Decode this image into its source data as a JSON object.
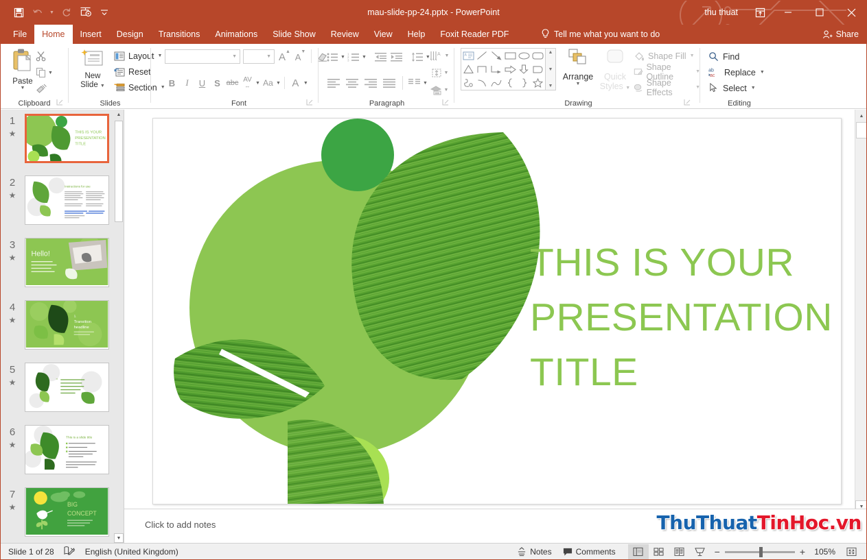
{
  "window": {
    "title": "mau-slide-pp-24.pptx  -  PowerPoint",
    "account": "thu thuat",
    "accent": "#b7472a",
    "quick_access": [
      "save-icon",
      "undo-icon",
      "redo-icon",
      "start-slideshow-icon",
      "customize-qat-icon"
    ],
    "buttons": {
      "ribbon_display": "ribbon-display-options-icon",
      "minimize": "—",
      "maximize": "☐",
      "close": "✕"
    }
  },
  "tabs": [
    {
      "label": "File",
      "active": false
    },
    {
      "label": "Home",
      "active": true
    },
    {
      "label": "Insert",
      "active": false
    },
    {
      "label": "Design",
      "active": false
    },
    {
      "label": "Transitions",
      "active": false
    },
    {
      "label": "Animations",
      "active": false
    },
    {
      "label": "Slide Show",
      "active": false
    },
    {
      "label": "Review",
      "active": false
    },
    {
      "label": "View",
      "active": false
    },
    {
      "label": "Help",
      "active": false
    },
    {
      "label": "Foxit Reader PDF",
      "active": false
    }
  ],
  "tellme": "Tell me what you want to do",
  "share": "Share",
  "ribbon": {
    "clipboard": {
      "label": "Clipboard",
      "paste": "Paste",
      "cut": "cut-icon",
      "copy": "copy-icon",
      "format_painter": "format-painter-icon"
    },
    "slides": {
      "label": "Slides",
      "new_slide": "New\nSlide",
      "new_slide_line1": "New",
      "new_slide_line2": "Slide",
      "layout": "Layout",
      "reset": "Reset",
      "section": "Section"
    },
    "font": {
      "label": "Font",
      "font_name": "",
      "font_name_placeholder": "",
      "font_size": "",
      "font_size_placeholder": "",
      "grow": "A",
      "shrink": "A",
      "clear_formatting": "clear-formatting-icon",
      "bold": "B",
      "italic": "I",
      "underline": "U",
      "shadow": "S",
      "strikethrough": "abc",
      "char_spacing": "AV",
      "change_case": "Aa",
      "font_color": "A"
    },
    "paragraph": {
      "label": "Paragraph",
      "bullets": "bullets-icon",
      "numbering": "numbering-icon",
      "decrease_indent": "decrease-indent-icon",
      "increase_indent": "increase-indent-icon",
      "line_spacing": "line-spacing-icon",
      "text_direction": "text-direction-icon",
      "align_text": "align-text-icon",
      "convert_smartart": "convert-to-smartart-icon",
      "align_left": "align-left-icon",
      "align_center": "align-center-icon",
      "align_right": "align-right-icon",
      "justify": "justify-icon",
      "columns": "columns-icon"
    },
    "drawing": {
      "label": "Drawing",
      "arrange": "Arrange",
      "quick_styles_line1": "Quick",
      "quick_styles_line2": "Styles",
      "shape_fill": "Shape Fill",
      "shape_outline": "Shape Outline",
      "shape_effects": "Shape Effects",
      "shapes": [
        "textbox",
        "line",
        "arrow",
        "rectangle",
        "oval",
        "rounded-rectangle",
        "triangle",
        "elbow-connector",
        "elbow-arrow-connector",
        "right-arrow-block",
        "down-arrow-block",
        "pentagon-tag",
        "scribble",
        "curve",
        "arc",
        "left-brace",
        "right-brace",
        "star"
      ]
    },
    "editing": {
      "label": "Editing",
      "find": "Find",
      "replace": "Replace",
      "select": "Select"
    }
  },
  "thumbnails": [
    {
      "number": "1",
      "selected": true,
      "kind": "title",
      "star": "★"
    },
    {
      "number": "2",
      "selected": false,
      "kind": "instructions",
      "star": "★"
    },
    {
      "number": "3",
      "selected": false,
      "kind": "hello",
      "star": "★"
    },
    {
      "number": "4",
      "selected": false,
      "kind": "transition",
      "star": "★"
    },
    {
      "number": "5",
      "selected": false,
      "kind": "quote",
      "star": "★"
    },
    {
      "number": "6",
      "selected": false,
      "kind": "bullets",
      "star": "★"
    },
    {
      "number": "7",
      "selected": false,
      "kind": "bigconcept",
      "star": "★"
    }
  ],
  "thumb_text": {
    "t1_title": "THIS IS YOUR\nPRESENTATION\nTITLE",
    "t2_title": "Instructions for use",
    "t3_title": "Hello!",
    "t4_title": "1.\nTransition\nheadline",
    "t6_title": "This is a slide title",
    "t7_line1": "BIG",
    "t7_line2": "CONCEPT"
  },
  "slide": {
    "title": "THIS IS YOUR\nPRESENTATION\nTITLE",
    "title_color": "#8CC751",
    "colors": {
      "circle_large_light": "#8DC652",
      "circle_dark_green": "#3CA544",
      "circle_bright_lime": "#A8E053",
      "leaf_green": "#4E9A32"
    }
  },
  "notes": {
    "placeholder": "Click to add notes"
  },
  "watermark": {
    "blue": "ThuThuat",
    "red": "TinHoc.vn"
  },
  "status": {
    "slide_counter": "Slide 1 of 28",
    "accessibility": "accessibility-checker-icon",
    "language": "English (United Kingdom)",
    "notes_label": "Notes",
    "comments_label": "Comments",
    "views": [
      "normal-view-icon",
      "slide-sorter-icon",
      "reading-view-icon",
      "slideshow-view-icon"
    ],
    "active_view": "normal-view-icon",
    "zoom_out": "−",
    "zoom_in": "+",
    "zoom_level": "105%",
    "fit_to_window": "fit-slide-to-window-icon"
  }
}
